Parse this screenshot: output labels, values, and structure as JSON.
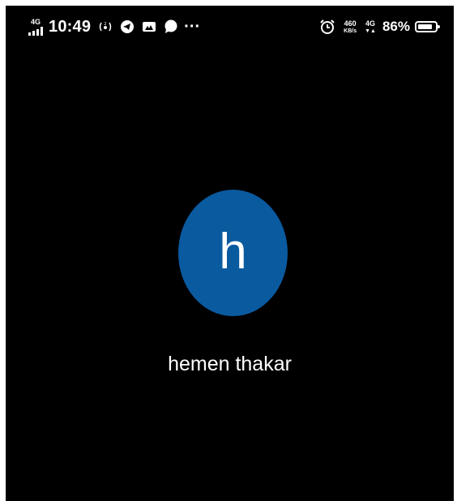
{
  "status_bar": {
    "network_type": "4G",
    "time": "10:49",
    "net_speed_value": "460",
    "net_speed_unit": "KB/s",
    "network_type_2": "4G",
    "data_arrows": "▼▲",
    "battery_percent": "86%",
    "battery_level": 0.86,
    "icons": [
      "signal-icon",
      "hotspot-icon",
      "telegram-icon",
      "game-controller-icon",
      "chat-bubble-icon",
      "more-icon",
      "alarm-icon",
      "battery-icon"
    ]
  },
  "contact": {
    "initial": "h",
    "name": "hemen thakar",
    "avatar_color": "#0a5aa0"
  },
  "colors": {
    "background": "#000000",
    "text": "#ffffff"
  }
}
